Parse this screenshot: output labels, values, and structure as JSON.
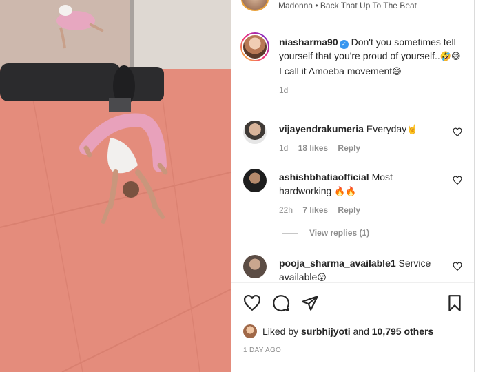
{
  "post": {
    "song_line": "Madonna • Back That Up To The Beat",
    "author": "niasharma90",
    "caption_line1": "Don't you sometimes tell yourself that you're proud of yourself..",
    "caption_emojis1": "🤣😅",
    "caption_line2": "I call it Amoeba movement",
    "caption_emoji2": "😅",
    "caption_age": "1d"
  },
  "comments": [
    {
      "user": "vijayendrakumeria",
      "text": "Everyday",
      "emoji": "🤘",
      "age": "1d",
      "likes": "18 likes",
      "reply": "Reply"
    },
    {
      "user": "ashishbhatiaofficial",
      "text": "Most hardworking",
      "emoji": "🔥🔥",
      "age": "22h",
      "likes": "7 likes",
      "reply": "Reply"
    },
    {
      "user": "pooja_sharma_available1",
      "text": "Service available",
      "emoji": "😮"
    }
  ],
  "view_replies": "View replies (1)",
  "actions": {
    "icons": [
      "heart-icon",
      "comment-icon",
      "share-icon",
      "bookmark-icon"
    ],
    "liked_prefix": "Liked by",
    "liked_user": "surbhijyoti",
    "liked_and": "and",
    "liked_count": "10,795 others",
    "time_ago": "1 DAY AGO"
  },
  "colors": {
    "verified": "#3897f0",
    "meta": "#8e8e8e",
    "mat": "#e48b7b"
  }
}
